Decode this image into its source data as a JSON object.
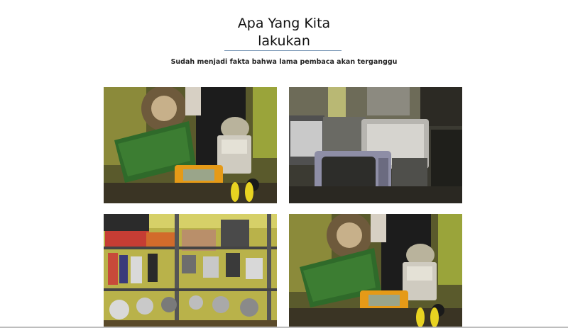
{
  "section": {
    "title_line1": "Apa Yang Kita",
    "title_line2": "lakukan",
    "subtitle": "Sudah menjadi fakta bahwa lama pembaca akan terganggu",
    "accent_color": "#6f8fb0"
  },
  "gallery": {
    "photos": [
      {
        "subject": "circuit-board-multimeter-workbench"
      },
      {
        "subject": "crt-televisions-workshop"
      },
      {
        "subject": "spare-parts-shelf"
      },
      {
        "subject": "circuit-board-multimeter-workbench"
      }
    ]
  }
}
